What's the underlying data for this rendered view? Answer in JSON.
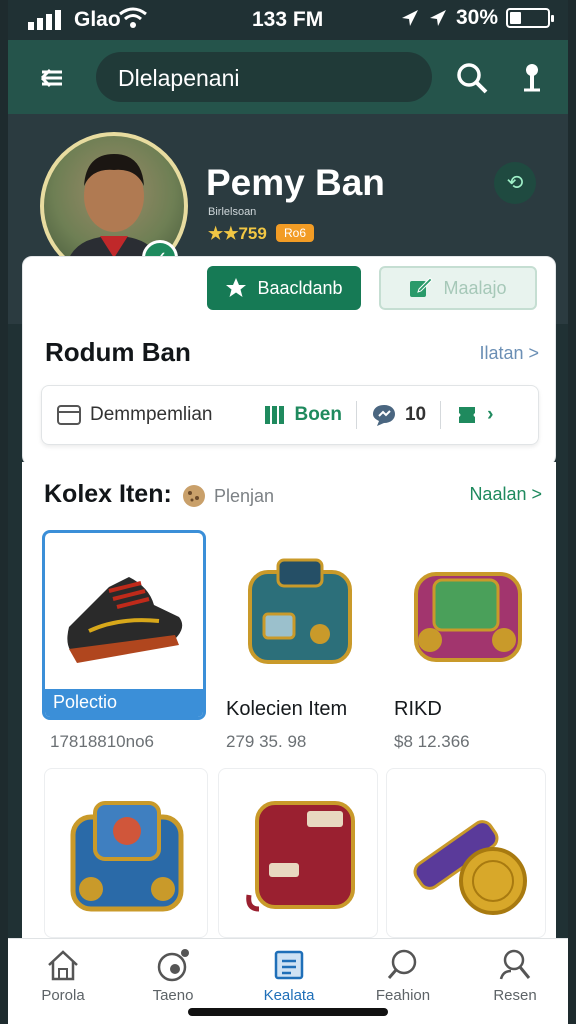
{
  "status_bar": {
    "carrier": "Glao",
    "time": "133 FM",
    "battery": "30%",
    "battery_level": 0.3
  },
  "search": {
    "value": "Dlelapenani"
  },
  "profile": {
    "name": "Pemy Ban",
    "subtitle": "Birlelsoan",
    "rating": "★★759",
    "badge": "Ro6",
    "primary_button": "Baacldanb",
    "secondary_button": "Maalajo"
  },
  "section": {
    "title": "Rodum Ban",
    "link": "Ilatan >",
    "info": {
      "label": "Demmpemlian",
      "status": "Boen",
      "count": "10"
    }
  },
  "items": {
    "title": "Kolex Iten:",
    "subtitle": "Plenjan",
    "link": "Naalan >",
    "tiles": [
      {
        "label": "Polectio",
        "price": "17818810no6",
        "icon": "sneaker-icon"
      },
      {
        "label": "Kolecien Item",
        "price": "279 35. 98",
        "icon": "teal-backpack-icon"
      },
      {
        "label": "RIKD",
        "price": "$8 12.366",
        "icon": "purple-backpack-icon"
      },
      {
        "label": "",
        "price": "",
        "icon": "blue-chest-icon"
      },
      {
        "label": "",
        "price": "",
        "icon": "red-backpack-icon"
      },
      {
        "label": "",
        "price": "",
        "icon": "telescope-coin-icon"
      }
    ]
  },
  "nav": [
    {
      "label": "Porola",
      "icon": "home-icon"
    },
    {
      "label": "Taeno",
      "icon": "gamepad-icon"
    },
    {
      "label": "Kealata",
      "icon": "catalog-icon"
    },
    {
      "label": "Feahion",
      "icon": "chat-search-icon"
    },
    {
      "label": "Resen",
      "icon": "profile-search-icon"
    }
  ],
  "colors": {
    "appbar": "#25544b",
    "primary": "#167a55",
    "active": "#1f6fb8",
    "selection": "#3b8fd8"
  }
}
